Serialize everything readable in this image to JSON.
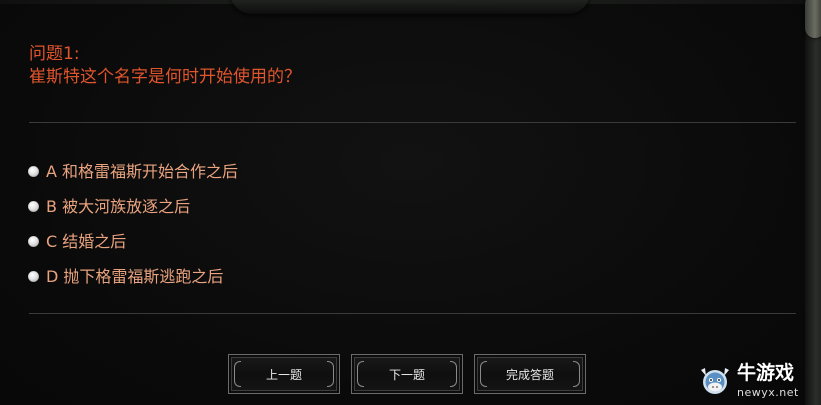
{
  "quiz": {
    "question_label": "问题1:",
    "question_text": "崔斯特这个名字是何时开始使用的？",
    "options": [
      {
        "letter": "A",
        "text": "A 和格雷福斯开始合作之后"
      },
      {
        "letter": "B",
        "text": "B 被大河族放逐之后"
      },
      {
        "letter": "C",
        "text": "C 结婚之后"
      },
      {
        "letter": "D",
        "text": "D 抛下格雷福斯逃跑之后"
      }
    ]
  },
  "buttons": {
    "prev_label": "上一题",
    "next_label": "下一题",
    "finish_label": "完成答题"
  },
  "watermark": {
    "title": "牛游戏",
    "url": "newyx.net"
  },
  "colors": {
    "question": "#e0552c",
    "option_text": "#e9a37f",
    "background": "#0b0b0b",
    "button_text": "#e8e8e8"
  },
  "icons": {
    "radio": "radio-button-icon",
    "watermark_logo": "bull-mascot-icon"
  }
}
